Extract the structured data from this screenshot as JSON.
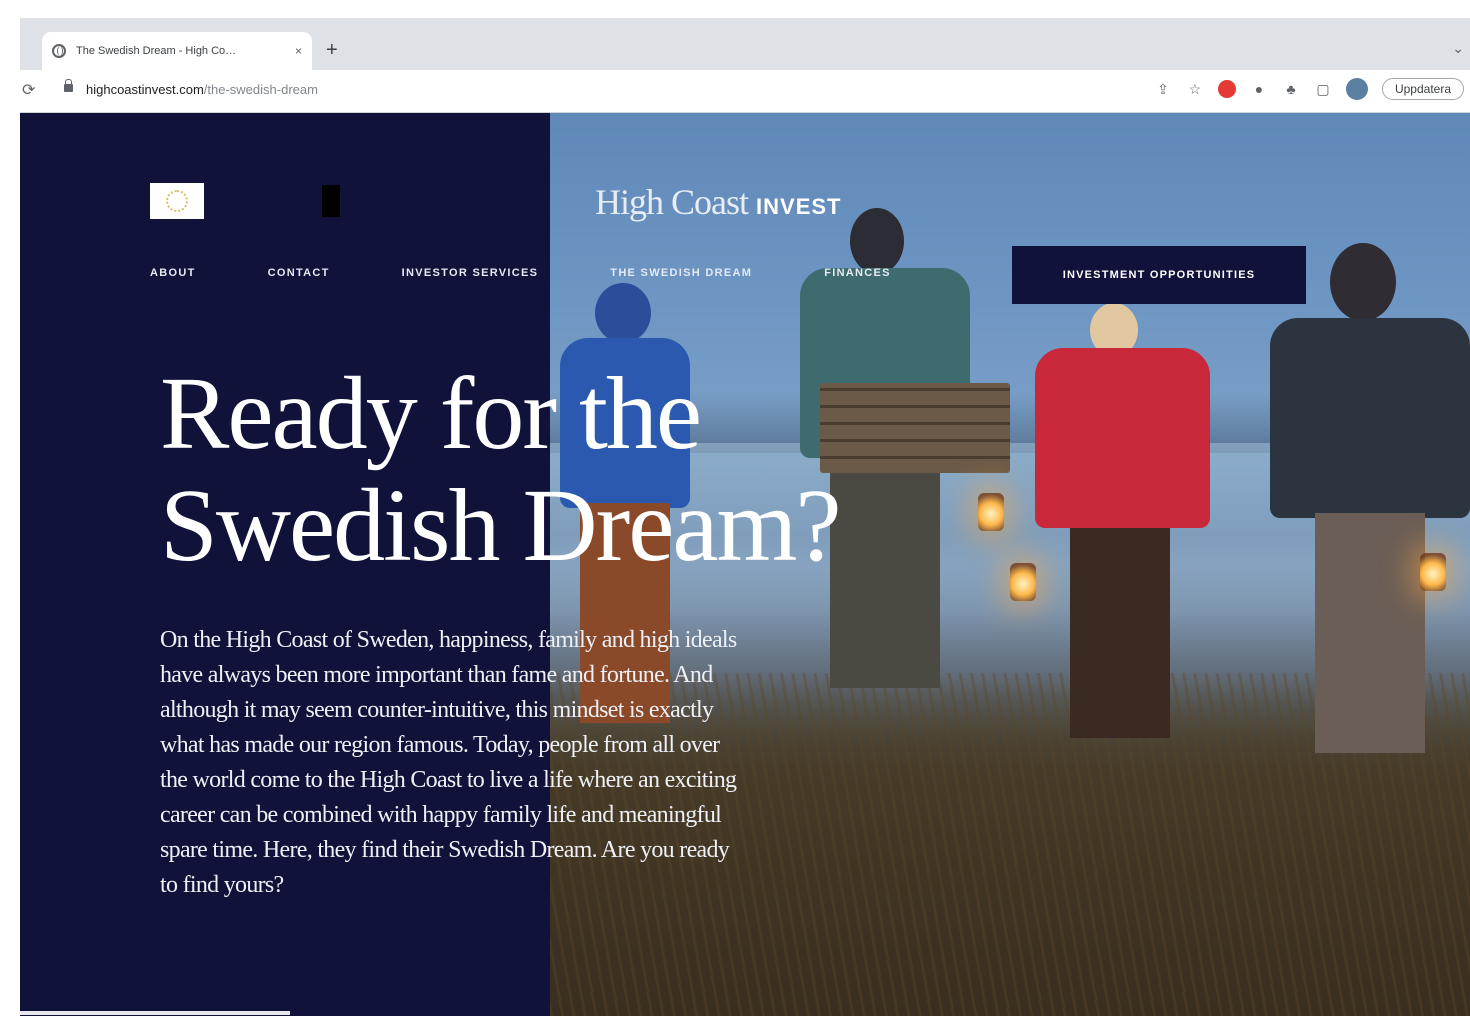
{
  "browser": {
    "tab_title": "The Swedish Dream - High Co…",
    "tab_close": "×",
    "new_tab": "+",
    "tab_menu": "⌄",
    "url_host": "highcoastinvest.com",
    "url_path": "/the-swedish-dream",
    "reload_icon": "⟳",
    "toolbar_icons": [
      "share-icon",
      "star-icon",
      "extension-red-icon",
      "extension-icon",
      "puzzle-icon",
      "sidepanel-icon",
      "profile-icon"
    ],
    "update_button": "Uppdatera"
  },
  "header": {
    "brand_serif": "High Coast",
    "brand_sans": "INVEST",
    "nav": [
      "ABOUT",
      "CONTACT",
      "INVESTOR SERVICES",
      "THE SWEDISH DREAM",
      "FINANCES"
    ],
    "cta": "INVESTMENT OPPORTUNITIES"
  },
  "hero": {
    "headline": "Ready for the Swedish Dream?",
    "intro": "On the High Coast of Sweden, happiness, family and high ideals have always been more important than fame and fortune. And although it may seem counter-intuitive, this mindset is exactly what has made our region famous. Today, people from all over the world come to the High Coast to live a life where an exciting career can be combined with happy family life and meaningful spare time. Here, they find their Swedish Dream. Are you ready to find yours?"
  },
  "colors": {
    "navy": "#10123a",
    "chrome_bg": "#dee1e6"
  }
}
